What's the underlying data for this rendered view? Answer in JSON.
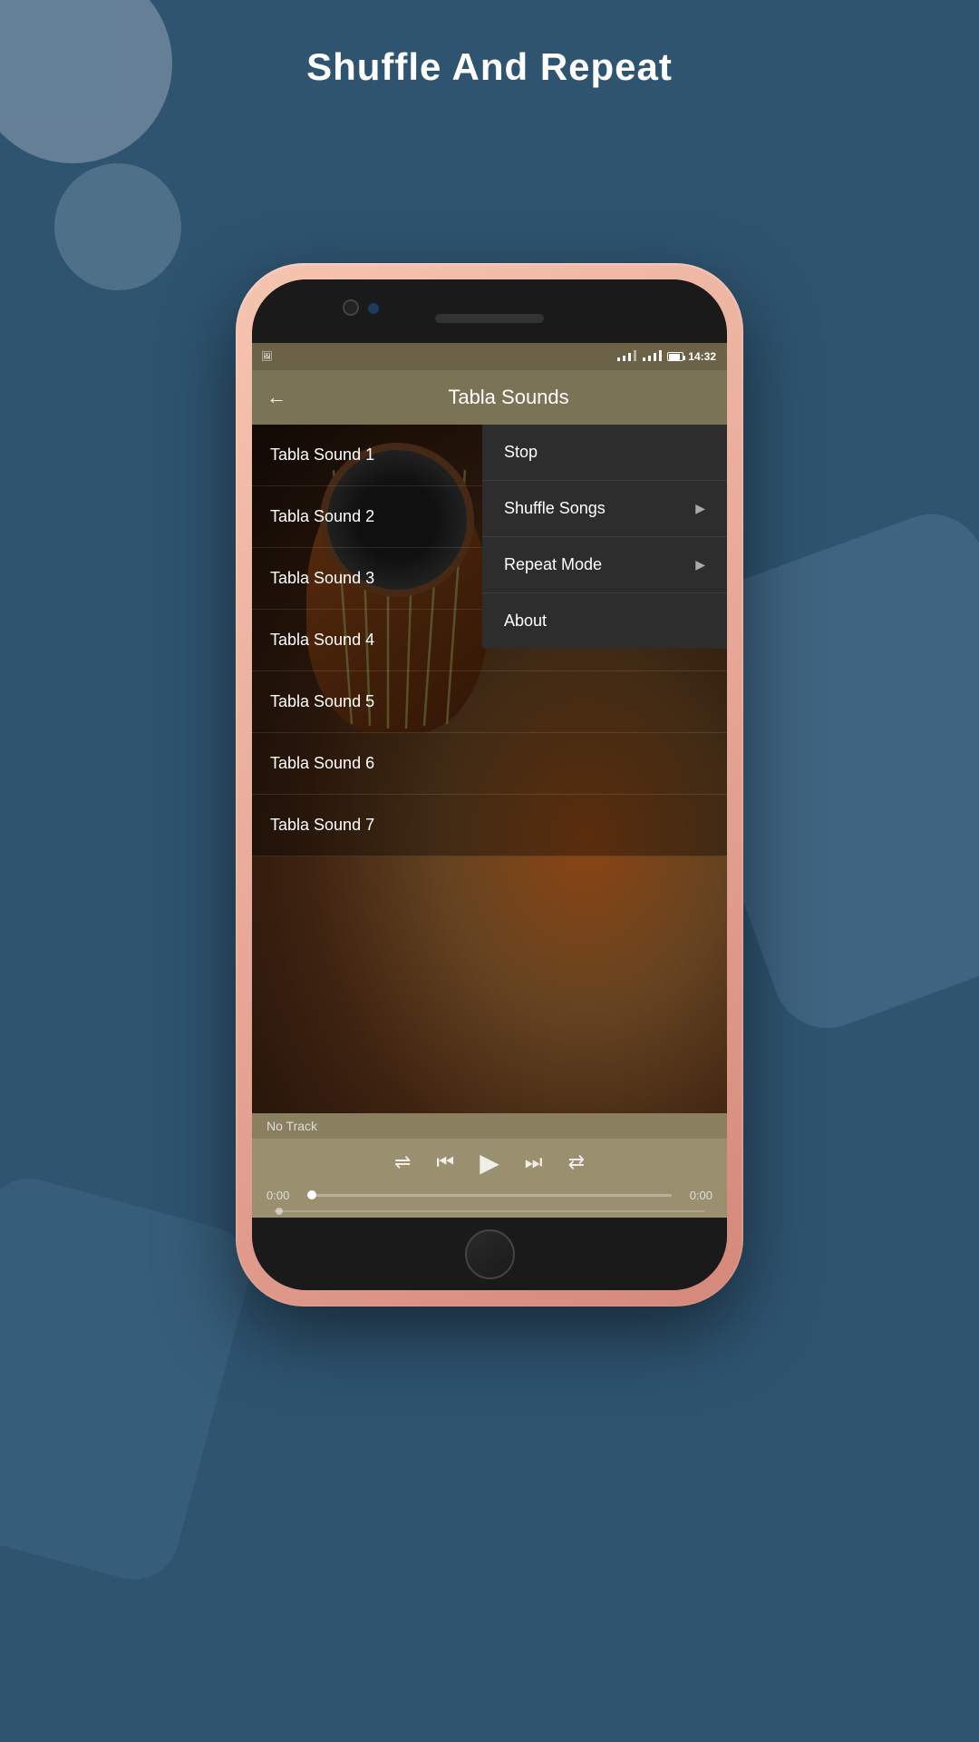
{
  "page": {
    "title": "Shuffle And Repeat",
    "background_color": "#2e5470"
  },
  "phone": {
    "status_bar": {
      "time": "14:32",
      "signal": "signal-icon",
      "wifi": "wifi-icon",
      "battery": "battery-icon",
      "notification": "notification-icon"
    },
    "app": {
      "header_title": "Tabla Sounds",
      "back_label": "←"
    },
    "song_list": [
      {
        "id": 1,
        "name": "Tabla Sound 1"
      },
      {
        "id": 2,
        "name": "Tabla Sound 2"
      },
      {
        "id": 3,
        "name": "Tabla Sound 3"
      },
      {
        "id": 4,
        "name": "Tabla Sound 4"
      },
      {
        "id": 5,
        "name": "Tabla Sound 5"
      },
      {
        "id": 6,
        "name": "Tabla Sound 6"
      },
      {
        "id": 7,
        "name": "Tabla Sound 7"
      }
    ],
    "dropdown_menu": {
      "items": [
        {
          "id": "stop",
          "label": "Stop",
          "has_submenu": false
        },
        {
          "id": "shuffle",
          "label": "Shuffle Songs",
          "has_submenu": true
        },
        {
          "id": "repeat",
          "label": "Repeat Mode",
          "has_submenu": true
        },
        {
          "id": "about",
          "label": "About",
          "has_submenu": false
        }
      ]
    },
    "player": {
      "now_playing": "No Track",
      "time_current": "0:00",
      "time_total": "0:00",
      "shuffle_icon": "⇌",
      "prev_icon": "⏮",
      "play_icon": "▶",
      "next_icon": "⏭",
      "repeat_icon": "⇄"
    }
  }
}
